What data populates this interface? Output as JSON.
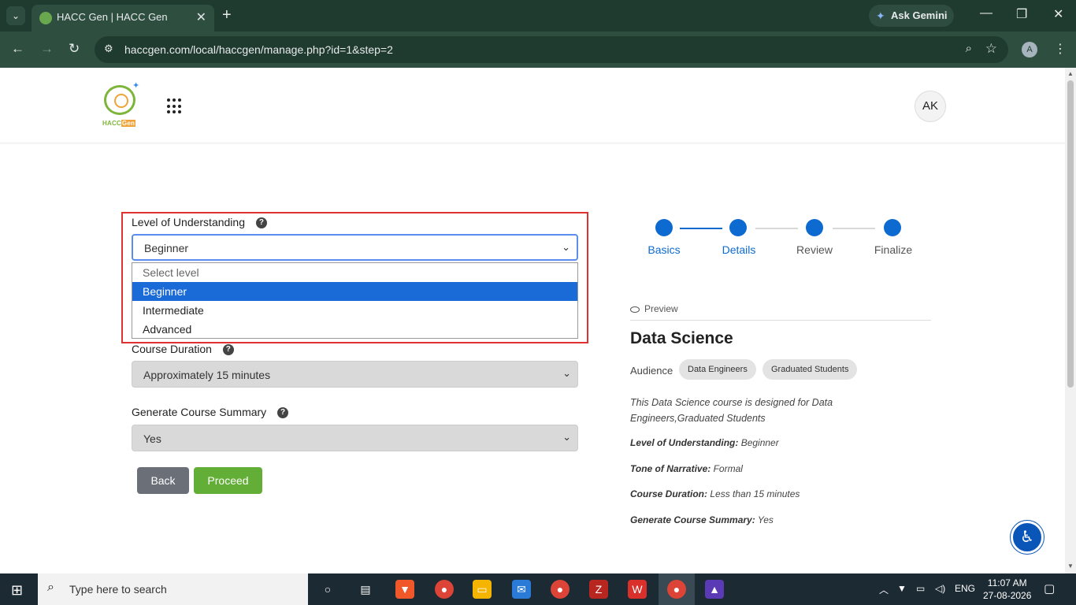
{
  "browser": {
    "tab_title": "HACC Gen | HACC Gen",
    "url": "haccgen.com/local/haccgen/manage.php?id=1&step=2",
    "ask_gemini_label": "Ask Gemini",
    "profile_initial": "A"
  },
  "header": {
    "logo_text_left": "HACC",
    "logo_text_right": "Gen",
    "avatar_initials": "AK"
  },
  "form": {
    "level": {
      "label": "Level of Understanding",
      "value": "Beginner",
      "options": [
        "Select level",
        "Beginner",
        "Intermediate",
        "Advanced"
      ],
      "selected_index": 1
    },
    "duration": {
      "label": "Course Duration",
      "value": "Approximately 15 minutes"
    },
    "summary": {
      "label": "Generate Course Summary",
      "value": "Yes"
    },
    "back_label": "Back",
    "proceed_label": "Proceed",
    "help_glyph": "?"
  },
  "stepper": {
    "steps": [
      "Basics",
      "Details",
      "Review",
      "Finalize"
    ],
    "active_color": "#0d6ad0"
  },
  "preview": {
    "heading": "Preview",
    "title": "Data Science",
    "audience_label": "Audience",
    "audience": [
      "Data Engineers",
      "Graduated Students"
    ],
    "description": "This Data Science course is designed for Data Engineers,Graduated Students",
    "meta": [
      {
        "label": "Level of Understanding:",
        "value": "Beginner"
      },
      {
        "label": "Tone of Narrative:",
        "value": "Formal"
      },
      {
        "label": "Course Duration:",
        "value": "Less than 15 minutes"
      },
      {
        "label": "Generate Course Summary:",
        "value": "Yes"
      }
    ]
  },
  "taskbar": {
    "search_placeholder": "Type here to search",
    "language": "ENG",
    "time": "11:07 AM",
    "date": "27-08-2026"
  },
  "colors": {
    "highlight": "#e03131",
    "proceed": "#63ae36",
    "back": "#6b7078",
    "selected_option": "#1a6ad8"
  }
}
